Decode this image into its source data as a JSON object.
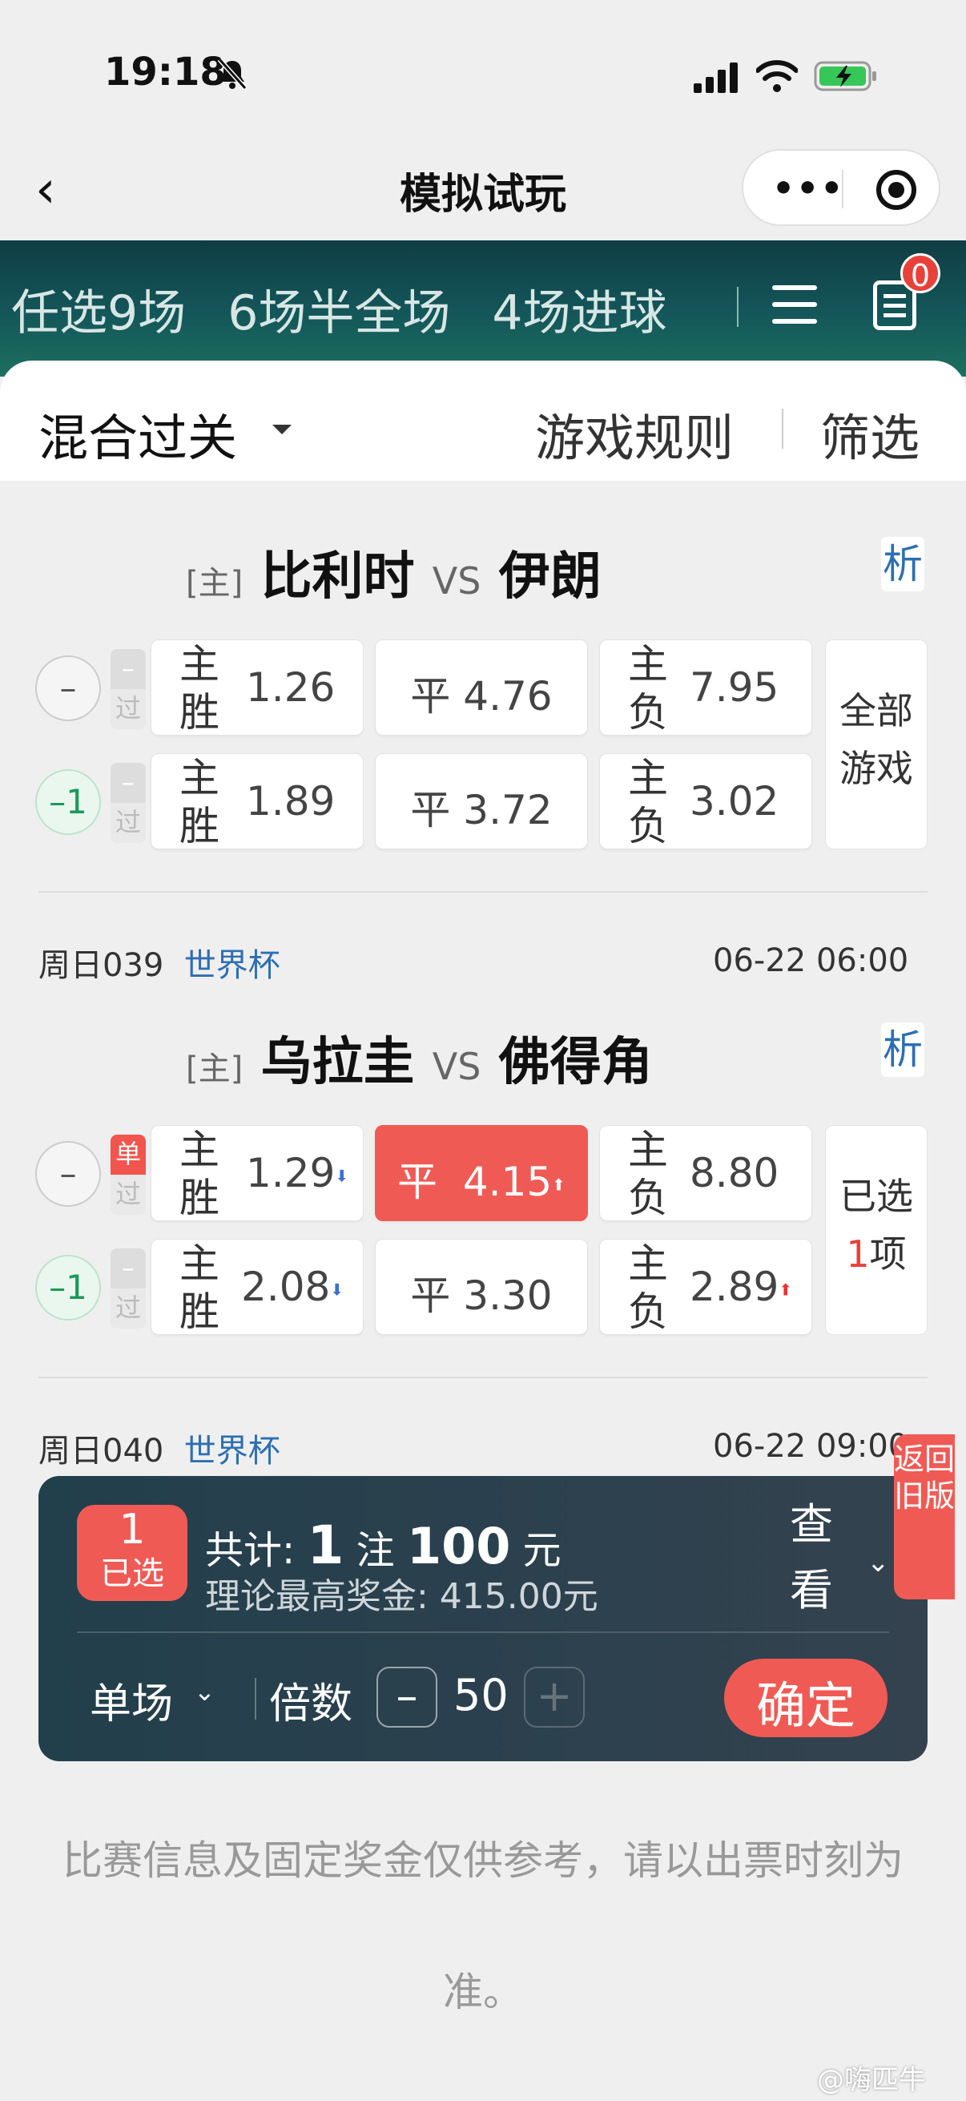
{
  "status": {
    "time": "19:18"
  },
  "nav": {
    "title": "模拟试玩",
    "more": "•••"
  },
  "banner": {
    "tabs": [
      "任选9场",
      "6场半全场",
      "4场进球"
    ],
    "cart_count": "0"
  },
  "filter": {
    "mode": "混合过关",
    "rules": "游戏规则",
    "filter": "筛选"
  },
  "matches": [
    {
      "host_tag": "[主]",
      "home": "比利时",
      "vs": "VS",
      "away": "伊朗",
      "analysis": "析",
      "rows": [
        {
          "handicap": "–",
          "pass_top": "–",
          "pass_bottom": "过",
          "win_label": "主胜",
          "win": "1.26",
          "draw_label": "平",
          "draw": "4.76",
          "lose_label": "主负",
          "lose": "7.95"
        },
        {
          "handicap": "–1",
          "pass_top": "–",
          "pass_bottom": "过",
          "win_label": "主胜",
          "win": "1.89",
          "draw_label": "平",
          "draw": "3.72",
          "lose_label": "主负",
          "lose": "3.02"
        }
      ],
      "side": [
        "全部",
        "游戏"
      ]
    },
    {
      "code": "周日039",
      "league": "世界杯",
      "time": "06-22 06:00",
      "host_tag": "[主]",
      "home": "乌拉圭",
      "vs": "VS",
      "away": "佛得角",
      "analysis": "析",
      "rows": [
        {
          "handicap": "–",
          "pass_top": "单",
          "pass_bottom": "过",
          "win_label": "主胜",
          "win": "1.29",
          "draw_label": "平",
          "draw": "4.15",
          "lose_label": "主负",
          "lose": "8.80"
        },
        {
          "handicap": "–1",
          "pass_top": "–",
          "pass_bottom": "过",
          "win_label": "主胜",
          "win": "2.08",
          "draw_label": "平",
          "draw": "3.30",
          "lose_label": "主负",
          "lose": "2.89"
        }
      ],
      "side_a": "已选",
      "side_num": "1",
      "side_b": "项"
    },
    {
      "code": "周日040",
      "league": "世界杯",
      "time": "06-22 09:00"
    }
  ],
  "bet": {
    "selected_count": "1",
    "selected_label": "已选",
    "total_prefix": "共计:",
    "bets": "1",
    "bets_unit": "注",
    "amount": "100",
    "amount_unit": "元",
    "max_prize": "理论最高奖金: 415.00元",
    "view_detail": "查看明细",
    "mode": "单场",
    "multiplier_label": "倍数",
    "minus": "–",
    "multiplier": "50",
    "plus": "+",
    "confirm": "确定"
  },
  "old_version": "返回旧版",
  "disclaimer": "比赛信息及固定奖金仅供参考，请以出票时刻为准。",
  "watermark": "@嗨匹牛"
}
